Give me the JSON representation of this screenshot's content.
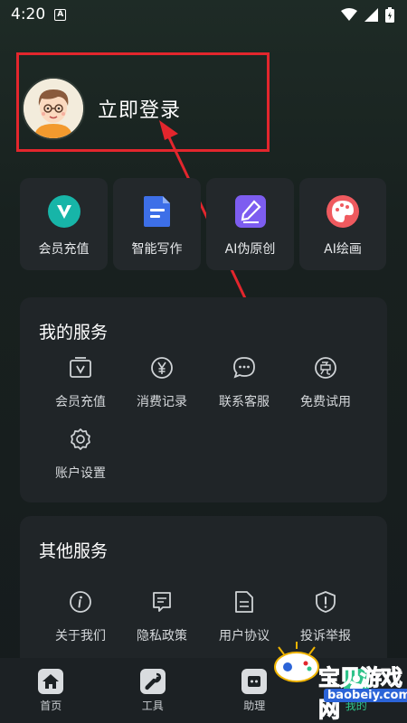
{
  "status_bar": {
    "time": "4:20"
  },
  "login": {
    "label": "立即登录"
  },
  "quick_actions": [
    {
      "label": "会员充值",
      "icon": "vip-icon",
      "color": "#17b5a8"
    },
    {
      "label": "智能写作",
      "icon": "document-icon",
      "color": "#3d6fe8"
    },
    {
      "label": "AI伪原创",
      "icon": "pen-icon",
      "color": "#7d5df0"
    },
    {
      "label": "AI绘画",
      "icon": "palette-icon",
      "color": "#ef5a5f"
    }
  ],
  "my_services": {
    "title": "我的服务",
    "items": [
      {
        "label": "会员充值",
        "icon": "vip-card-icon"
      },
      {
        "label": "消费记录",
        "icon": "yen-icon"
      },
      {
        "label": "联系客服",
        "icon": "chat-icon"
      },
      {
        "label": "免费试用",
        "icon": "free-icon"
      },
      {
        "label": "账户设置",
        "icon": "gear-icon"
      }
    ]
  },
  "other_services": {
    "title": "其他服务",
    "items": [
      {
        "label": "关于我们",
        "icon": "info-icon"
      },
      {
        "label": "隐私政策",
        "icon": "policy-icon"
      },
      {
        "label": "用户协议",
        "icon": "agreement-icon"
      },
      {
        "label": "投诉举报",
        "icon": "report-icon"
      }
    ]
  },
  "tabbar": {
    "items": [
      {
        "label": "首页",
        "icon": "home-icon"
      },
      {
        "label": "工具",
        "icon": "wrench-icon"
      },
      {
        "label": "助理",
        "icon": "assistant-icon"
      },
      {
        "label": "我的",
        "icon": "profile-icon"
      }
    ],
    "active_color": "#2fc38a"
  },
  "watermark": {
    "text": "宝贝游戏网",
    "url": "baobeiy.com"
  }
}
